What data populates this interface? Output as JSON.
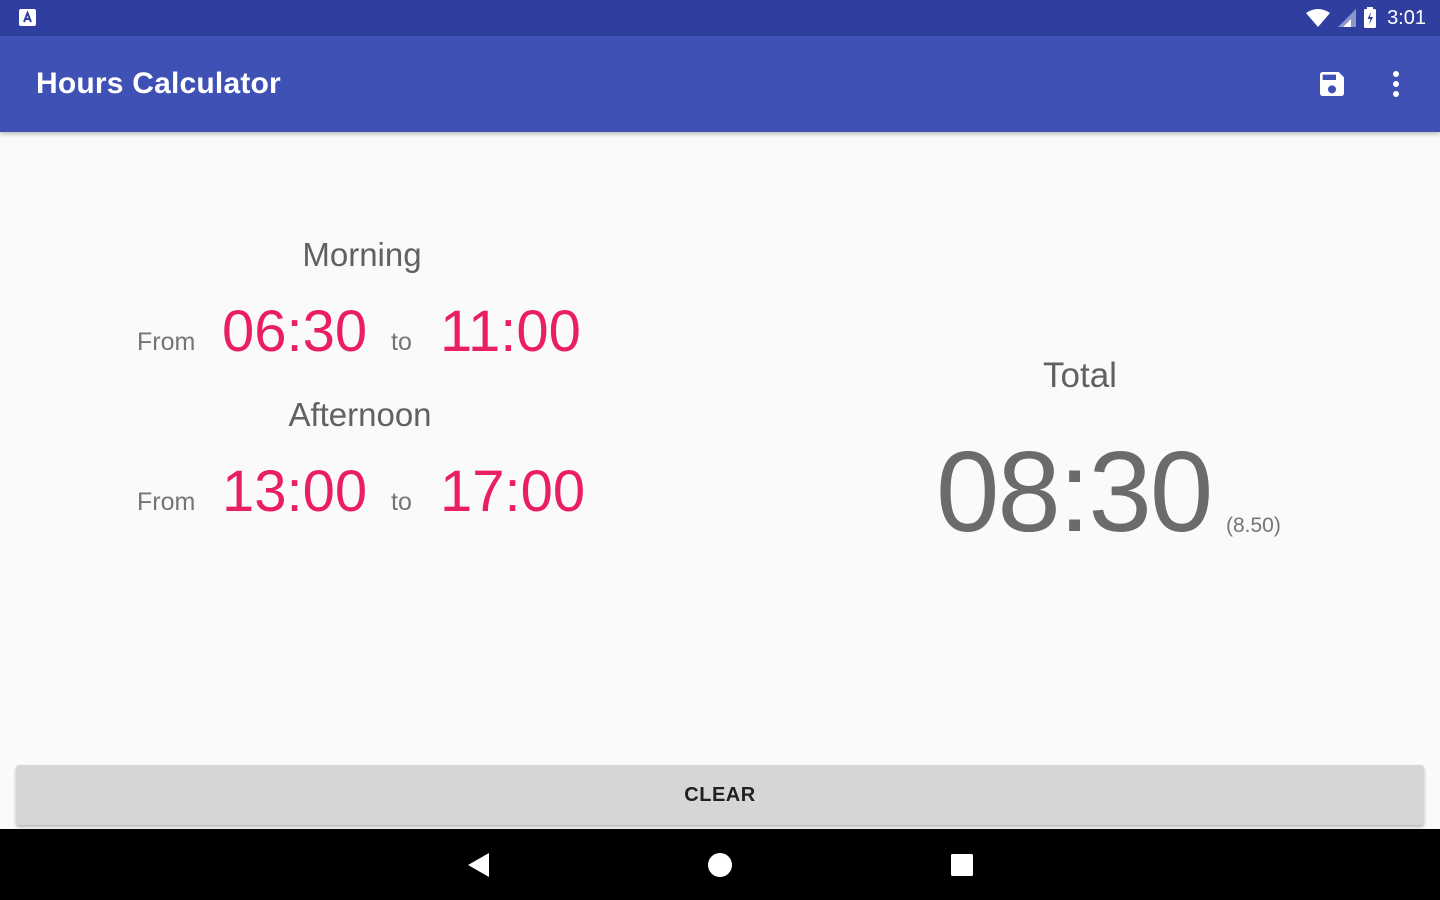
{
  "status_bar": {
    "time": "3:01",
    "icons": [
      "notification-app-icon",
      "wifi-icon",
      "signal-icon",
      "battery-icon"
    ]
  },
  "app_bar": {
    "title": "Hours Calculator",
    "actions": [
      "save-icon",
      "more-vert-icon"
    ]
  },
  "morning": {
    "label": "Morning",
    "from_label": "From",
    "from_time": "06:30",
    "to_label": "to",
    "to_time": "11:00"
  },
  "afternoon": {
    "label": "Afternoon",
    "from_label": "From",
    "from_time": "13:00",
    "to_label": "to",
    "to_time": "17:00"
  },
  "total": {
    "label": "Total",
    "value": "08:30",
    "decimal": "(8.50)"
  },
  "clear_button": {
    "label": "CLEAR"
  },
  "nav_bar": {
    "buttons": [
      "back-icon",
      "home-icon",
      "recents-icon"
    ]
  },
  "colors": {
    "status_bar": "#303f9f",
    "app_bar": "#3f51b5",
    "accent": "#e91e63",
    "background": "#fafafa",
    "button": "#d6d6d6"
  }
}
